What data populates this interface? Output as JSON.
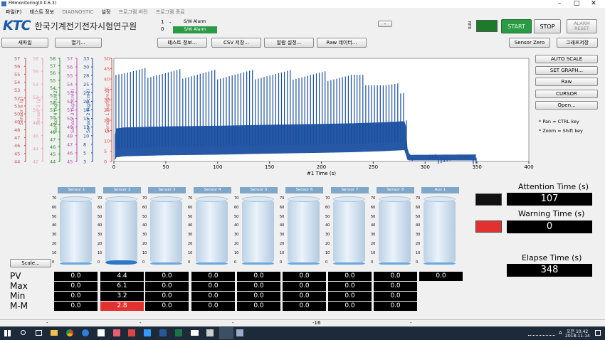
{
  "window": {
    "title": "FMmonitoring(0.0.6.3)",
    "minimize": "–",
    "maximize": "□",
    "close": "✕"
  },
  "menu": [
    "파일(F)",
    "테스트 정보",
    "DIAGNOSTIC",
    "설정",
    "프로그램 버전",
    "프로그램 종료"
  ],
  "logo": {
    "mark": "KTC",
    "name": "한국기계전기전자시험연구원"
  },
  "alarm": {
    "num1": "1",
    "dash": "-",
    "num2": "0",
    "label": "S/W Alarm",
    "button": "S/W Alarm"
  },
  "small_button": "-",
  "run_label": "RUN",
  "colors": {
    "start_green": "#2a9a44",
    "run_led": "#1d7a2a",
    "series_blue": "#1a4fa0",
    "red": "#e3312f",
    "header_blue": "#7fa7c9"
  },
  "top_buttons": {
    "start": "START",
    "stop": "STOP",
    "alarm_reset": "ALARM\nRESET"
  },
  "toolbar": {
    "new_file": "새파일",
    "open": "열기...",
    "test_info": "테스트 정보...",
    "csv_save": "CSV 저장...",
    "alarm_setting": "알람 설정...",
    "raw_data": "Raw 데이터...",
    "sensor_zero": "Sensor Zero",
    "graph_save": "그래프저장"
  },
  "right_panel": {
    "auto_scale": "AUTO SCALE",
    "set_graph": "SET GRAPH...",
    "raw": "Raw",
    "cursor": "CURSOR",
    "open": "Open...",
    "hint_pan": "* Pan = CTRL key",
    "hint_zoom": "* Zoom = Shift key"
  },
  "chart_data": {
    "type": "line",
    "xlabel": "#1 Time (s)",
    "xlim": [
      0,
      400
    ],
    "x_ticks": [
      "0",
      "50",
      "100",
      "150",
      "200",
      "250",
      "300",
      "350",
      "400"
    ],
    "series": [
      {
        "name": "Sensor 2",
        "color": "#1a4fa0",
        "envelope": {
          "x": [
            0,
            2,
            10,
            50,
            100,
            150,
            200,
            230,
            260,
            280,
            285,
            350
          ],
          "high": [
            0,
            46,
            45.5,
            45,
            44.8,
            44.5,
            44,
            43.5,
            39,
            37.5,
            3.5,
            3.4
          ],
          "low": [
            0,
            6,
            6.5,
            7,
            7.3,
            7.8,
            8.2,
            8.5,
            9,
            9.5,
            1.6,
            1.8
          ]
        }
      }
    ],
    "y_axes": [
      {
        "label": "Sensor 6 (g)",
        "color": "#c0504d",
        "ticks": [
          "57",
          "56",
          "55",
          "54",
          "53",
          "52",
          "51",
          "50",
          "49",
          "48",
          "47",
          "46",
          "45",
          "44"
        ]
      },
      {
        "label": "Sensor 5 (g)",
        "color": "#e6a0b8",
        "ticks": [
          "58",
          "56",
          "54",
          "52",
          "50",
          "48",
          "46",
          "44",
          "42"
        ]
      },
      {
        "label": "Sensor 4 (kgf/cm2)",
        "color": "#2e8b2e",
        "ticks": [
          "58",
          "57",
          "56",
          "55",
          "54",
          "53",
          "52",
          "51",
          "50",
          "49",
          "48",
          "47",
          "46",
          "45",
          "44"
        ]
      },
      {
        "label": "Sensor 3 (kgf/cm2)",
        "color": "#b04fb0",
        "ticks": [
          "57",
          "56",
          "55",
          "54",
          "53",
          "52",
          "51",
          "50",
          "49",
          "48",
          "47",
          "46",
          "45"
        ]
      },
      {
        "label": "Sensor 2 (kgf/cm2)",
        "color": "#1a4fa0",
        "ticks": [
          "33",
          "30",
          "28",
          "25",
          "23",
          "20",
          "18",
          "15",
          "13",
          "10",
          "8",
          "5",
          "3"
        ]
      },
      {
        "label": "Sensor 1 (kgf/cm2)",
        "color": "#e05050",
        "ticks": [
          "50",
          "45",
          "40",
          "35",
          "30",
          "25",
          "20",
          "15",
          "10",
          "5",
          "0"
        ]
      }
    ]
  },
  "tanks": {
    "names": [
      "Sensor 1",
      "Sensor 2",
      "Sensor 3",
      "Sensor 4",
      "Sensor 5",
      "Sensor 6",
      "Sensor 7",
      "Sensor 8",
      "Aux 1"
    ],
    "scale_ticks": [
      "70",
      "60",
      "50",
      "40",
      "30",
      "20",
      "10",
      "0"
    ],
    "levels": [
      0,
      4.4,
      0,
      0,
      0,
      0,
      0,
      0,
      0
    ]
  },
  "scale_button": "Scale...",
  "row_labels": [
    "PV",
    "Max",
    "Min",
    "M-M"
  ],
  "values": {
    "pv": [
      "0.0",
      "4.4",
      "0.0",
      "0.0",
      "0.0",
      "0.0",
      "0.0",
      "0.0",
      "0.0"
    ],
    "max": [
      "0.0",
      "6.1",
      "0.0",
      "0.0",
      "0.0",
      "0.0",
      "0.0",
      "0.0"
    ],
    "min": [
      "0.0",
      "3.2",
      "0.0",
      "0.0",
      "0.0",
      "0.0",
      "0.0",
      "0.0"
    ],
    "mm": [
      "0.0",
      "2.8",
      "0.0",
      "0.0",
      "0.0",
      "0.0",
      "0.0",
      "0.0"
    ]
  },
  "timers": {
    "attention_label": "Attention Time (s)",
    "attention_value": "107",
    "warning_label": "Warning Time (s)",
    "warning_value": "0",
    "elapse_label": "Elapse Time (s)",
    "elapse_value": "348"
  },
  "status_bar": [
    "-",
    "-",
    "-",
    "-16",
    "-"
  ],
  "taskbar": {
    "time": "오전 10:42",
    "date": "2018-11-14",
    "lang": "A"
  }
}
